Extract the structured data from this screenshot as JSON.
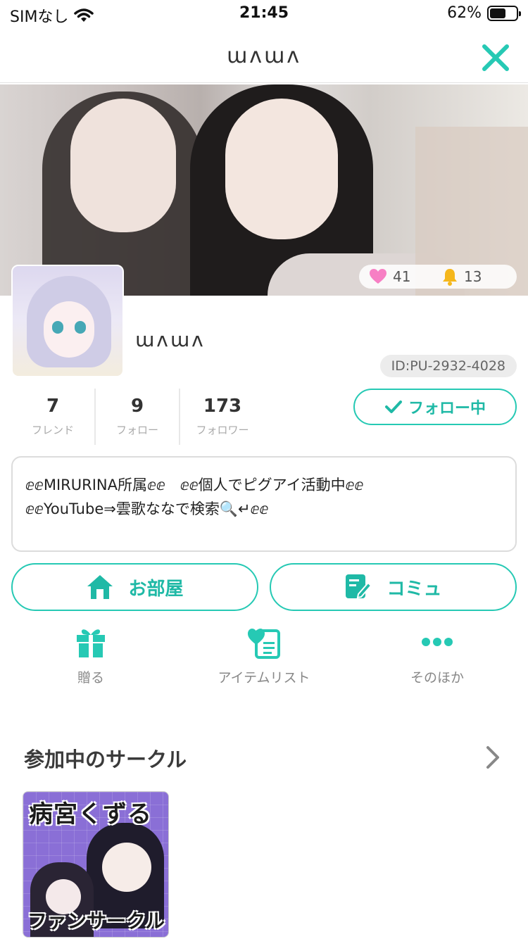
{
  "status_bar": {
    "carrier": "SIMなし",
    "time": "21:45",
    "battery_percent": "62%",
    "battery_level": 0.62
  },
  "nav": {
    "title": "ɯᴧɯᴧ",
    "close_icon": "close-icon",
    "accent_color": "#26c9b4"
  },
  "cover": {
    "likes": "41",
    "notifications": "13"
  },
  "profile": {
    "name": "ɯᴧɯᴧ",
    "id": "ID:PU-2932-4028",
    "counts": [
      {
        "value": "7",
        "label": "フレンド"
      },
      {
        "value": "9",
        "label": "フォロー"
      },
      {
        "value": "173",
        "label": "フォロワー"
      }
    ],
    "follow_button": "フォロー中",
    "bio_lines": [
      "ⅇⅇMIRURINA所属ⅇⅇ　ⅇⅇ個人でピグアイ活動中ⅇⅇ",
      "ⅇⅇYouTube⇒雲歌ななで検索🔍↵ⅇⅇ"
    ]
  },
  "actions": {
    "room": "お部屋",
    "community": "コミュ"
  },
  "menu": [
    {
      "label": "贈る",
      "icon": "gift-icon"
    },
    {
      "label": "アイテムリスト",
      "icon": "heart-list-icon"
    },
    {
      "label": "そのほか",
      "icon": "more-icon"
    }
  ],
  "circles": {
    "heading": "参加中のサークル",
    "items": [
      {
        "title_top": "病宮くずる",
        "title_bottom": "ファンサークル"
      }
    ]
  }
}
